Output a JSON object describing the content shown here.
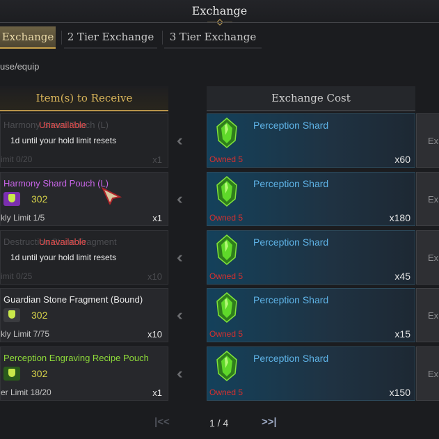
{
  "window": {
    "title": "Exchange"
  },
  "tabs": [
    {
      "label": "Exchange",
      "active": true
    },
    {
      "label": "2 Tier Exchange",
      "active": false
    },
    {
      "label": "3 Tier Exchange",
      "active": false
    }
  ],
  "filter_text": "use/equip",
  "headers": {
    "receive": "Item(s) to Receive",
    "cost": "Exchange Cost"
  },
  "rows": [
    {
      "item": {
        "name": "Harmony Shard Pouch (L)",
        "name_color": "#4d4e52",
        "level": "",
        "limit": "imit 0/20",
        "qty": "x1",
        "unavailable": true,
        "unavailable_text": "Unavailable",
        "note": "1d until your hold limit resets"
      },
      "cost": {
        "name": "Perception Shard",
        "owned": "Owned 5",
        "qty": "x60"
      },
      "button": "Ex"
    },
    {
      "item": {
        "name": "Harmony Shard Pouch (L)",
        "name_color": "#c865e8",
        "badge_color": "#7b2fb0",
        "level": "302",
        "limit": "kly Limit 1/5",
        "qty": "x1",
        "unavailable": false
      },
      "cost": {
        "name": "Perception Shard",
        "owned": "Owned 5",
        "qty": "x180"
      },
      "button": "Ex"
    },
    {
      "item": {
        "name": "Destruction Stone Fragment",
        "name_color": "#4d4e52",
        "level": "",
        "limit": "imit 0/25",
        "qty": "x10",
        "unavailable": true,
        "unavailable_text": "Unavailable",
        "note": "1d until your hold limit resets"
      },
      "cost": {
        "name": "Perception Shard",
        "owned": "Owned 5",
        "qty": "x45"
      },
      "button": "Ex"
    },
    {
      "item": {
        "name": "Guardian Stone Fragment (Bound)",
        "name_color": "#e8e8e8",
        "badge_color": "#3a3b3f",
        "level": "302",
        "limit": "kly Limit 7/75",
        "qty": "x10",
        "unavailable": false
      },
      "cost": {
        "name": "Perception Shard",
        "owned": "Owned 5",
        "qty": "x15"
      },
      "button": "Ex"
    },
    {
      "item": {
        "name": "Perception Engraving Recipe Pouch",
        "name_color": "#8fdc3a",
        "badge_color": "#2a5a1c",
        "level": "302",
        "limit": "er Limit 18/20",
        "qty": "x1",
        "unavailable": false
      },
      "cost": {
        "name": "Perception Shard",
        "owned": "Owned 5",
        "qty": "x150"
      },
      "button": "Ex"
    }
  ],
  "pager": {
    "page": "1 / 4",
    "prev": "|<<",
    "next": ">>|"
  },
  "colors": {
    "accent_gold": "#c9a24a",
    "cost_name": "#5fb4e8",
    "owned_red": "#d8302e",
    "unavailable_red": "#e24b4b"
  }
}
